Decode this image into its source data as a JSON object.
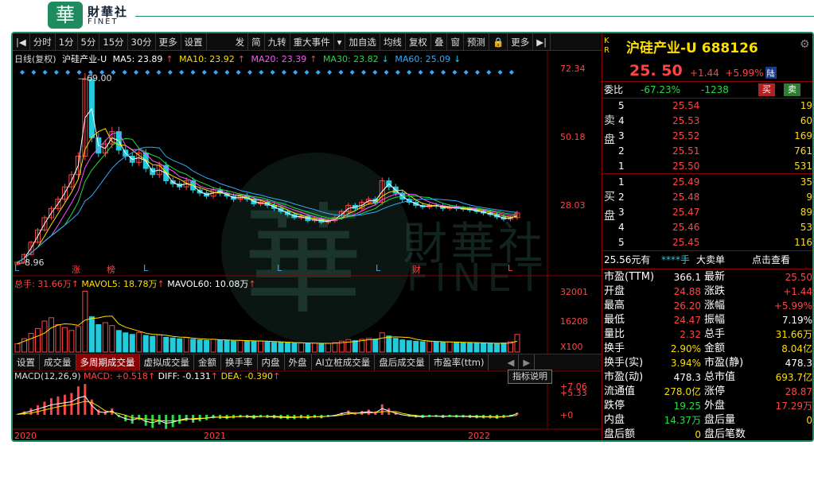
{
  "logo": {
    "char": "華",
    "name": "財華社",
    "sub": "FINET"
  },
  "toolbar": {
    "items": [
      "|◀",
      "分时",
      "1分",
      "5分",
      "15分",
      "30分",
      "更多",
      "设置",
      "发",
      "简",
      "九转",
      "重大事件",
      "▾",
      "加自选",
      "均线",
      "复权",
      "叠",
      "窗",
      "预测",
      "🔒",
      "更多",
      "▶|"
    ]
  },
  "info": {
    "period": "日线(复权)",
    "name": "沪硅产业-U",
    "ma5": "MA5: 23.89",
    "ma10": "MA10: 23.92",
    "ma20": "MA20: 23.39",
    "ma30": "MA30: 23.82",
    "ma60": "MA60: 25.09"
  },
  "price_axis": [
    "72.34",
    "50.18",
    "28.03",
    "32001",
    "16208",
    "X100",
    "+7.06",
    "+5.33",
    "+0"
  ],
  "annotations": {
    "high": "69.00",
    "low": "8.96",
    "markers": [
      "L",
      "涨",
      "榜",
      "L",
      "L",
      "L",
      "财",
      "L"
    ]
  },
  "volume_info": {
    "total": "总手: 31.66万",
    "mavol5": "MAVOL5: 18.78万",
    "mavol60": "MAVOL60: 10.08万"
  },
  "tabs": [
    "设置",
    "成交量",
    "多周期成交量",
    "虚拟成交量",
    "金额",
    "换手率",
    "内盘",
    "外盘",
    "AI立桩成交量",
    "盘后成交量",
    "市盈率(ttm)"
  ],
  "tab_active": "多周期成交量",
  "macd_info": {
    "name": "MACD(12,26,9)",
    "macd": "MACD: +0.518",
    "diff": "DIFF: -0.131",
    "dea": "DEA: -0.390"
  },
  "indicator_button": "指标说明",
  "years": [
    "2020",
    "2021",
    "2022"
  ],
  "quote": {
    "kr": "K R",
    "title": "沪硅产业-U 688126",
    "price": "25. 50",
    "change": "+1.44",
    "change_pct": "+5.99%",
    "market": "陆",
    "weibi_label": "委比",
    "weibi": "-67.23%",
    "weicha": "-1238",
    "buy_btn": "买",
    "sell_btn": "卖",
    "sell_label": "卖盘",
    "buy_label": "买盘",
    "asks": [
      {
        "lvl": "5",
        "price": "25.54",
        "vol": "19"
      },
      {
        "lvl": "4",
        "price": "25.53",
        "vol": "60"
      },
      {
        "lvl": "3",
        "price": "25.52",
        "vol": "169"
      },
      {
        "lvl": "2",
        "price": "25.51",
        "vol": "761"
      },
      {
        "lvl": "1",
        "price": "25.50",
        "vol": "531"
      }
    ],
    "bids": [
      {
        "lvl": "1",
        "price": "25.49",
        "vol": "35"
      },
      {
        "lvl": "2",
        "price": "25.48",
        "vol": "9"
      },
      {
        "lvl": "3",
        "price": "25.47",
        "vol": "89"
      },
      {
        "lvl": "4",
        "price": "25.46",
        "vol": "53"
      },
      {
        "lvl": "5",
        "price": "25.45",
        "vol": "116"
      }
    ],
    "big_order": {
      "amount": "25.56元有",
      "stars": "****手",
      "label": "大卖单",
      "link": "点击查看"
    },
    "stats": [
      {
        "l1": "市盈(TTM)",
        "v1": "366.1",
        "c1": "white",
        "l2": "最新",
        "v2": "25.50",
        "c2": "red"
      },
      {
        "l1": "开盘",
        "v1": "24.88",
        "c1": "red",
        "l2": "涨跌",
        "v2": "+1.44",
        "c2": "red"
      },
      {
        "l1": "最高",
        "v1": "26.20",
        "c1": "red",
        "l2": "涨幅",
        "v2": "+5.99%",
        "c2": "red"
      },
      {
        "l1": "最低",
        "v1": "24.47",
        "c1": "red",
        "l2": "振幅",
        "v2": "7.19%",
        "c2": "white"
      },
      {
        "l1": "量比",
        "v1": "2.32",
        "c1": "red",
        "l2": "总手",
        "v2": "31.66万",
        "c2": "yellow"
      },
      {
        "l1": "换手",
        "v1": "2.90%",
        "c1": "yellow",
        "l2": "金额",
        "v2": "8.04亿",
        "c2": "yellow"
      },
      {
        "l1": "换手(实)",
        "v1": "3.94%",
        "c1": "yellow",
        "l2": "市盈(静)",
        "v2": "478.3",
        "c2": "white"
      },
      {
        "l1": "市盈(动)",
        "v1": "478.3",
        "c1": "white",
        "l2": "总市值",
        "v2": "693.7亿",
        "c2": "yellow"
      },
      {
        "l1": "流通值",
        "v1": "278.0亿",
        "c1": "yellow",
        "l2": "涨停",
        "v2": "28.87",
        "c2": "red"
      },
      {
        "l1": "跌停",
        "v1": "19.25",
        "c1": "green",
        "l2": "外盘",
        "v2": "17.29万",
        "c2": "red"
      },
      {
        "l1": "内盘",
        "v1": "14.37万",
        "c1": "green",
        "l2": "盘后量",
        "v2": "0",
        "c2": "yellow"
      },
      {
        "l1": "盘后额",
        "v1": "0",
        "c1": "yellow",
        "l2": "盘后笔数",
        "v2": "",
        "c2": "white"
      }
    ]
  },
  "colors": {
    "up": "#ff4444",
    "down": "#22ccdd",
    "ma5": "#ffffff",
    "ma10": "#ffdf00",
    "ma20": "#ff55ff",
    "ma30": "#22dd44",
    "ma60": "#33aaff",
    "brand": "#1f8b5f"
  },
  "chart_data": {
    "type": "candlestick",
    "x_start": "2020",
    "x_end": "2022",
    "ylim": [
      8.96,
      72.34
    ],
    "close": [
      9.5,
      12,
      16,
      20,
      24,
      27,
      30,
      34,
      38,
      44,
      69,
      50,
      45,
      48,
      52,
      46,
      44,
      42,
      45,
      40,
      38,
      41,
      36,
      35,
      34,
      36,
      33,
      32,
      31,
      33,
      32,
      31,
      30,
      31,
      30,
      28.5,
      29,
      28,
      27,
      26,
      25,
      24,
      24.5,
      23,
      23.5,
      22.5,
      23,
      24,
      26,
      28,
      27,
      29,
      30,
      29,
      36,
      34,
      32,
      30,
      29,
      28,
      27.5,
      28,
      27.8,
      27,
      27.5,
      27,
      26.8,
      26.5,
      26,
      25.5,
      25,
      24.2,
      23.5,
      24,
      25.5
    ],
    "volume": [
      4200,
      6800,
      9500,
      12000,
      15800,
      17500,
      14000,
      12500,
      11000,
      13000,
      31000,
      18000,
      14000,
      15000,
      13500,
      11000,
      9800,
      9000,
      10000,
      8500,
      8000,
      8800,
      7500,
      7200,
      6800,
      7400,
      6500,
      6200,
      6000,
      6500,
      6100,
      5900,
      5600,
      5900,
      5700,
      5400,
      5600,
      5200,
      5000,
      4900,
      4700,
      4500,
      4600,
      4400,
      4500,
      4300,
      4400,
      4800,
      5600,
      6400,
      5800,
      6500,
      7000,
      6600,
      9800,
      8200,
      7000,
      6200,
      5800,
      5500,
      5300,
      5400,
      5200,
      5000,
      5100,
      4900,
      4800,
      4700,
      4600,
      4500,
      4400,
      4300,
      4600,
      5200,
      9000
    ],
    "macd": [
      0.2,
      0.8,
      1.5,
      2.2,
      3.0,
      3.8,
      4.2,
      4.6,
      5.0,
      6.5,
      7.06,
      3.5,
      1.2,
      0.8,
      1.5,
      -0.5,
      -1.5,
      -2.0,
      -1.2,
      -2.5,
      -3.0,
      -2.2,
      -3.2,
      -2.8,
      -2.0,
      -1.4,
      -1.8,
      -1.5,
      -1.2,
      -0.8,
      -0.9,
      -1.0,
      -0.8,
      -0.6,
      -0.7,
      -0.9,
      -0.6,
      -0.7,
      -0.8,
      -0.9,
      -1.0,
      -1.0,
      -0.8,
      -1.0,
      -0.7,
      -0.8,
      -0.5,
      -0.2,
      0.5,
      1.0,
      0.6,
      0.9,
      1.2,
      0.8,
      2.4,
      1.5,
      0.6,
      0.0,
      -0.4,
      -0.6,
      -0.7,
      -0.5,
      -0.5,
      -0.7,
      -0.5,
      -0.6,
      -0.6,
      -0.7,
      -0.8,
      -0.8,
      -0.8,
      -0.9,
      -0.7,
      -0.4,
      0.518
    ]
  }
}
